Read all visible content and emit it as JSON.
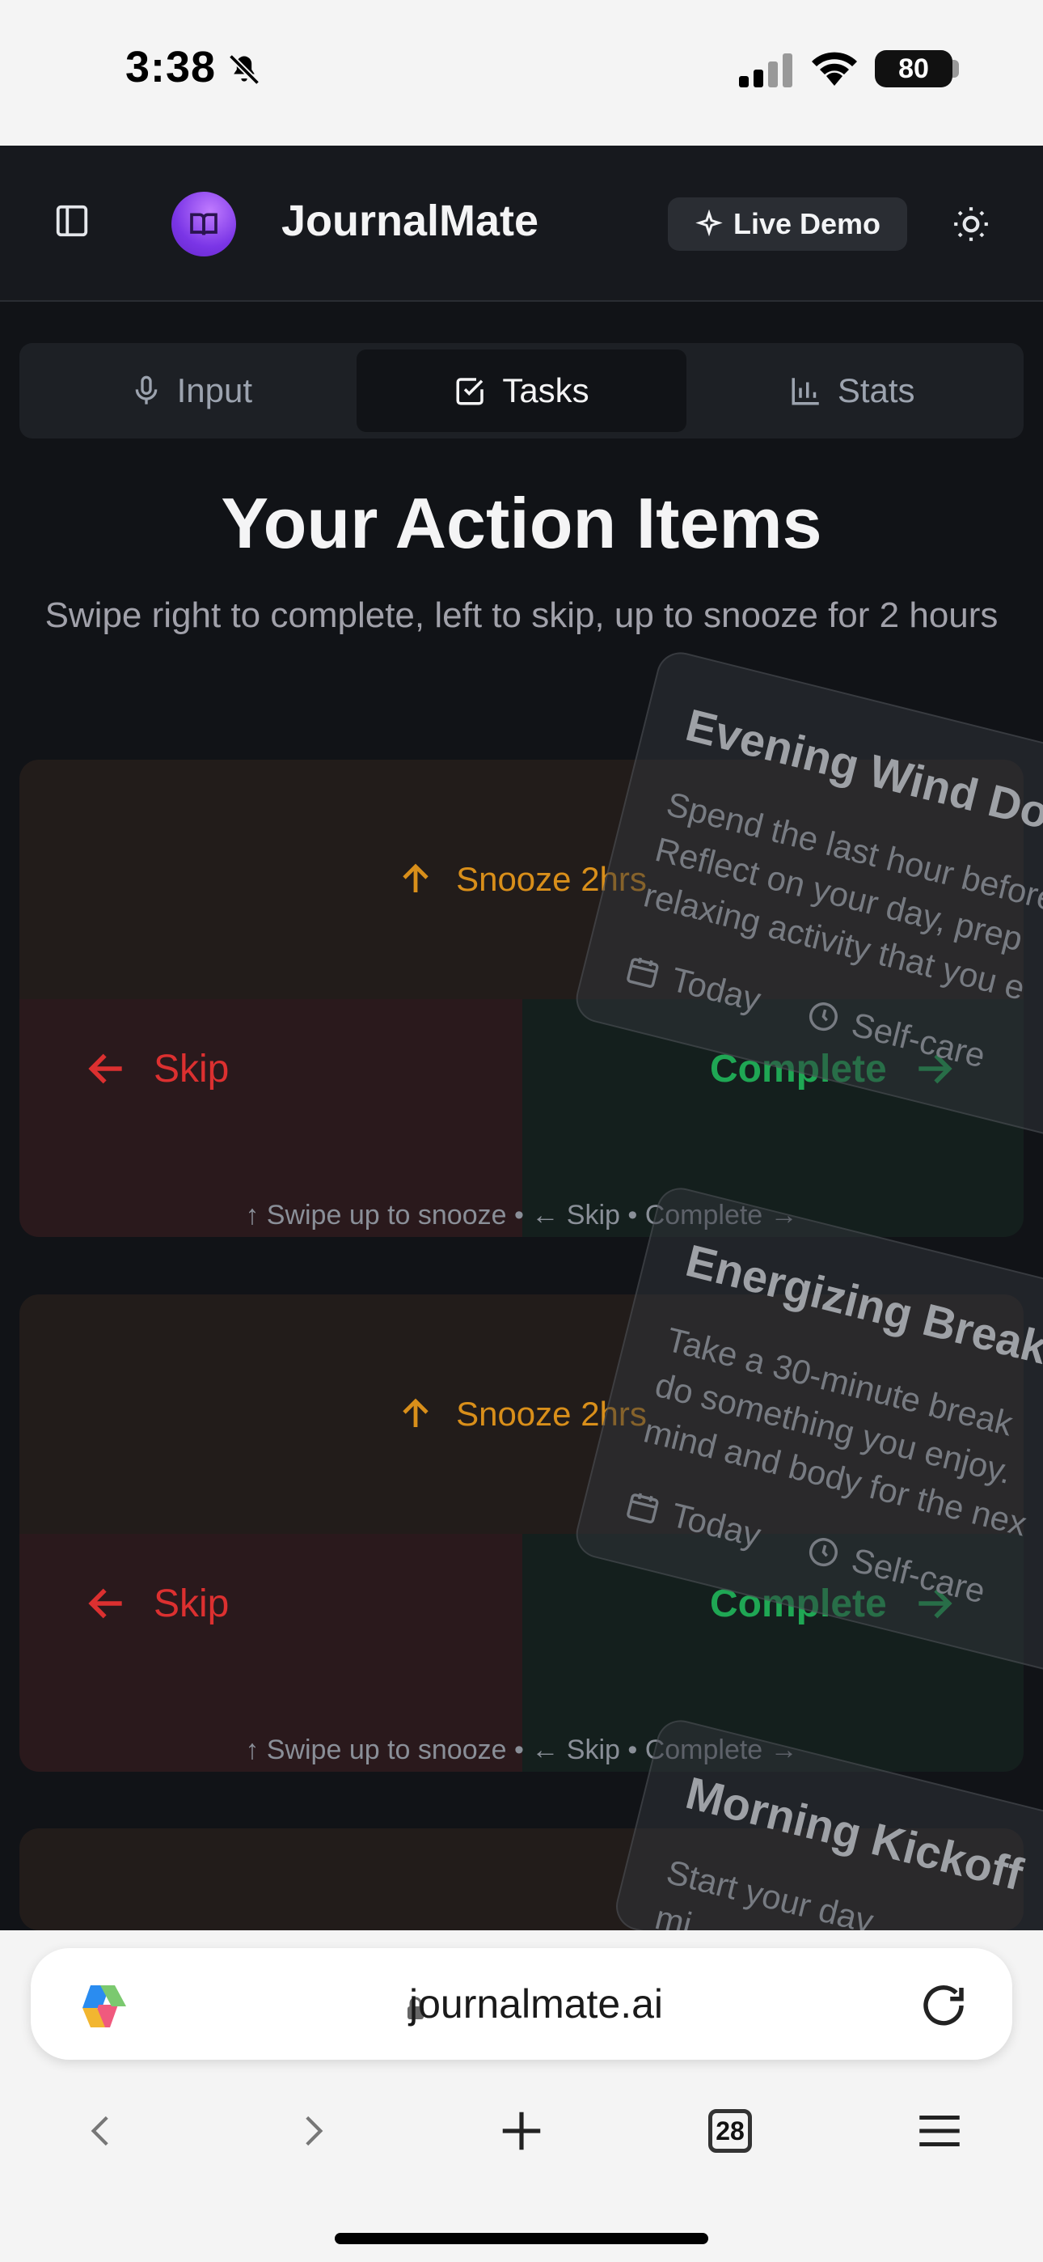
{
  "status": {
    "time": "3:38",
    "battery": "80"
  },
  "header": {
    "title": "JournalMate",
    "live_demo": "Live Demo"
  },
  "tabs": [
    {
      "label": "Input"
    },
    {
      "label": "Tasks"
    },
    {
      "label": "Stats"
    }
  ],
  "page": {
    "title": "Your Action Items",
    "subtitle": "Swipe right to complete, left to skip, up to snooze for 2 hours"
  },
  "swipe": {
    "snooze": "Snooze 2hrs",
    "skip": "Skip",
    "complete": "Complete",
    "hint": "↑ Swipe up to snooze • ← Skip • Complete →"
  },
  "tasks": [
    {
      "title": "Evening Wind Down",
      "desc_lines": [
        "Spend the last hour before",
        "Reflect on your day, prep",
        "relaxing activity that you e"
      ],
      "date": "Today",
      "category": "Self-care"
    },
    {
      "title": "Energizing Break",
      "desc_lines": [
        "Take a 30-minute break",
        "do something you enjoy.",
        "mind and body for the nex"
      ],
      "date": "Today",
      "category": "Self-care"
    },
    {
      "title": "Morning Kickoff",
      "desc_lines": [
        "Start your day",
        "mi"
      ],
      "date": "",
      "category": ""
    }
  ],
  "browser": {
    "url": "journalmate.ai",
    "tab_count": "28"
  }
}
